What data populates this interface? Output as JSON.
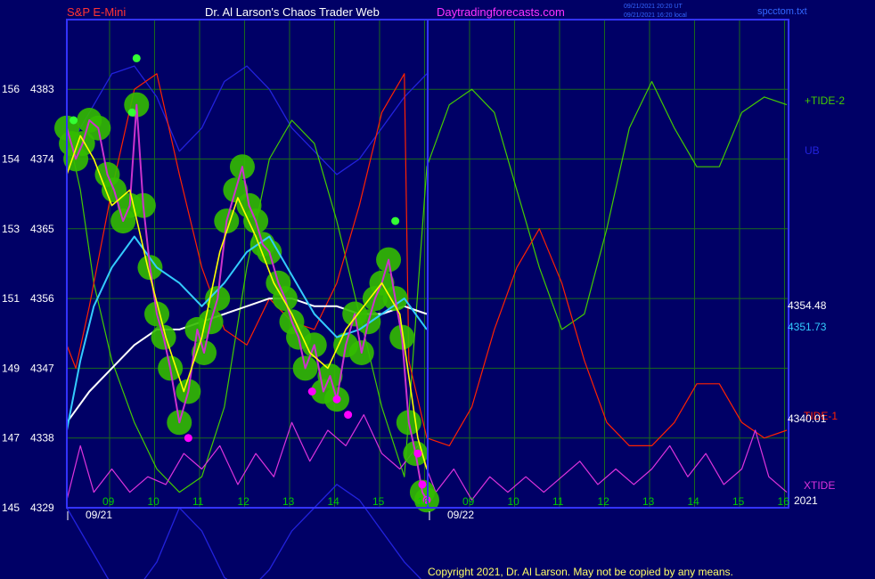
{
  "header": {
    "symbol": "S&P E-Mini",
    "title": "Dr. Al Larson's Chaos Trader Web",
    "site": "Daytradingforecasts.com",
    "stamp1": "09/21/2021 20:20 UT",
    "stamp2": "09/21/2021 16:20 local",
    "file": "spcctom.txt"
  },
  "copyright": "Copyright 2021, Dr. Al Larson. May not be copied by any means.",
  "colors": {
    "background": "#000066",
    "plot_border": "#3333ff",
    "grid": "#1a6b1a",
    "axis_text": "#ffffff",
    "hour_text": "#00cc00",
    "tide2": "#44cc00",
    "ub": "#2222dd",
    "xtide": "#dd33dd",
    "tide1": "#ff2200",
    "avg_white": "#ffffff",
    "avg_cyan": "#33ccff",
    "price": "#cc33cc",
    "smoothed": "#ffff00",
    "glow": "#33bb00",
    "high_dot": "#33ff33",
    "low_dot": "#ff00ff"
  },
  "chart_data": {
    "type": "line",
    "title": "S&P E-Mini",
    "y_ticks": [
      {
        "left": "145",
        "right": "4329"
      },
      {
        "left": "147",
        "right": "4338"
      },
      {
        "left": "149",
        "right": "4347"
      },
      {
        "left": "151",
        "right": "4356"
      },
      {
        "left": "153",
        "right": "4365"
      },
      {
        "left": "154",
        "right": "4374"
      },
      {
        "left": "156",
        "right": "4383"
      }
    ],
    "ylim": [
      4329,
      4390
    ],
    "x_hour_labels": [
      "09",
      "10",
      "11",
      "12",
      "13",
      "14",
      "15",
      "16",
      "09",
      "10",
      "11",
      "12",
      "13",
      "14",
      "15",
      "16"
    ],
    "date_labels": [
      "09/21",
      "09/22"
    ],
    "right_labels": [
      {
        "text": "+TIDE-2",
        "color": "#44cc00"
      },
      {
        "text": "UB",
        "color": "#2222dd"
      },
      {
        "text": "4354.48",
        "color": "#ffffff"
      },
      {
        "text": "4351.73",
        "color": "#33ccff"
      },
      {
        "text": "TIDE-1",
        "color": "#ff2200"
      },
      {
        "text": "4340.01",
        "color": "#ffffff"
      },
      {
        "text": "XTIDE",
        "color": "#dd33dd"
      },
      {
        "text": "2021",
        "color": "#ffffff"
      }
    ],
    "grid": true,
    "series": [
      {
        "name": "+TIDE-2",
        "x": [
          0,
          0.3,
          0.6,
          1.0,
          1.5,
          2.0,
          2.5,
          3.0,
          3.5,
          4.0,
          4.5,
          5.0,
          5.5,
          6.0,
          6.5,
          7.0,
          7.5,
          8.0,
          8.5,
          9.0,
          9.5,
          10.0,
          10.5,
          11.0,
          11.5,
          12.0,
          12.5,
          13.0,
          13.5,
          14.0,
          14.5,
          15.0,
          15.5,
          16.0
        ],
        "values": [
          4378,
          4370,
          4358,
          4348,
          4340,
          4334,
          4331,
          4333,
          4342,
          4360,
          4374,
          4379,
          4376,
          4366,
          4354,
          4342,
          4333,
          4373,
          4381,
          4383,
          4380,
          4370,
          4360,
          4352,
          4354,
          4365,
          4378,
          4384,
          4378,
          4373,
          4373,
          4380,
          4382,
          4381
        ]
      },
      {
        "name": "UB",
        "x": [
          0,
          0.5,
          1.0,
          1.5,
          2.0,
          2.5,
          3.0,
          3.5,
          4.0,
          4.5,
          5.0,
          5.5,
          6.0,
          6.5,
          7.0,
          7.5,
          8.0
        ],
        "values": [
          4375,
          4380,
          4385,
          4386,
          4382,
          4375,
          4378,
          4384,
          4386,
          4383,
          4378,
          4375,
          4372,
          4374,
          4378,
          4382,
          4385
        ]
      },
      {
        "name": "TIDE-1",
        "x": [
          0,
          0.2,
          0.5,
          1.0,
          1.5,
          2.0,
          2.5,
          3.0,
          3.5,
          4.0,
          4.5,
          5.0,
          5.5,
          6.0,
          6.5,
          7.0,
          7.5,
          7.6,
          8.0,
          8.5,
          9.0,
          9.5,
          10.0,
          10.5,
          11.0,
          11.5,
          12.0,
          12.5,
          13.0,
          13.5,
          14.0,
          14.5,
          15.0,
          15.5,
          16.0
        ],
        "values": [
          4350,
          4347,
          4355,
          4370,
          4383,
          4385,
          4372,
          4360,
          4352,
          4350,
          4356,
          4353,
          4352,
          4358,
          4368,
          4380,
          4385,
          4348,
          4338,
          4337,
          4342,
          4352,
          4360,
          4365,
          4358,
          4348,
          4340,
          4337,
          4337,
          4340,
          4345,
          4345,
          4340,
          4338,
          4339
        ]
      },
      {
        "name": "XTIDE",
        "x": [
          0,
          0.3,
          0.6,
          1.0,
          1.4,
          1.8,
          2.2,
          2.6,
          3.0,
          3.4,
          3.8,
          4.2,
          4.6,
          5.0,
          5.4,
          5.8,
          6.2,
          6.6,
          7.0,
          7.4,
          7.8,
          8.2,
          8.6,
          9.0,
          9.4,
          9.8,
          10.2,
          10.6,
          11.0,
          11.4,
          11.8,
          12.2,
          12.6,
          13.0,
          13.4,
          13.8,
          14.2,
          14.6,
          15.0,
          15.3,
          15.6,
          16.0
        ],
        "values": [
          4330,
          4337,
          4331,
          4334,
          4331,
          4333,
          4332,
          4336,
          4334,
          4337,
          4332,
          4336,
          4333,
          4340,
          4335,
          4339,
          4337,
          4341,
          4336,
          4334,
          4337,
          4331,
          4334,
          4330,
          4333,
          4331,
          4333,
          4331,
          4333,
          4335,
          4332,
          4334,
          4332,
          4334,
          4337,
          4333,
          4336,
          4332,
          4334,
          4339,
          4333,
          4331
        ]
      },
      {
        "name": "avg-white",
        "x": [
          0,
          0.5,
          1.0,
          1.5,
          2.0,
          2.5,
          3.0,
          3.5,
          4.0,
          4.5,
          5.0,
          5.5,
          6.0,
          6.5,
          7.0,
          7.5,
          8.0
        ],
        "values": [
          4340,
          4344,
          4347,
          4350,
          4352,
          4352,
          4353,
          4354,
          4355,
          4356,
          4356,
          4355,
          4355,
          4354,
          4354,
          4355,
          4354
        ]
      },
      {
        "name": "avg-cyan",
        "x": [
          0,
          0.3,
          0.6,
          1.0,
          1.5,
          2.0,
          2.5,
          3.0,
          3.5,
          4.0,
          4.5,
          5.0,
          5.5,
          6.0,
          6.5,
          7.0,
          7.5,
          8.0
        ],
        "values": [
          4339,
          4348,
          4355,
          4360,
          4364,
          4360,
          4358,
          4355,
          4358,
          4362,
          4364,
          4359,
          4354,
          4351,
          4352,
          4354,
          4356,
          4352
        ]
      },
      {
        "name": "price",
        "x": [
          0,
          0.1,
          0.2,
          0.35,
          0.5,
          0.7,
          0.9,
          1.05,
          1.25,
          1.4,
          1.55,
          1.7,
          1.85,
          2.0,
          2.15,
          2.3,
          2.5,
          2.7,
          2.9,
          3.05,
          3.2,
          3.35,
          3.55,
          3.75,
          3.9,
          4.05,
          4.2,
          4.35,
          4.5,
          4.7,
          4.85,
          5.0,
          5.15,
          5.3,
          5.5,
          5.7,
          5.85,
          6.0,
          6.2,
          6.4,
          6.55,
          6.7,
          6.85,
          7.0,
          7.15,
          7.3,
          7.45,
          7.6,
          7.75,
          7.9,
          8.0
        ],
        "values": [
          4378,
          4376,
          4374,
          4376,
          4379,
          4378,
          4372,
          4370,
          4366,
          4368,
          4381,
          4368,
          4360,
          4354,
          4351,
          4347,
          4340,
          4344,
          4352,
          4349,
          4353,
          4356,
          4366,
          4370,
          4373,
          4368,
          4366,
          4363,
          4362,
          4358,
          4356,
          4353,
          4351,
          4347,
          4350,
          4344,
          4346,
          4343,
          4350,
          4354,
          4349,
          4353,
          4356,
          4358,
          4361,
          4356,
          4351,
          4340,
          4336,
          4331,
          4330
        ]
      },
      {
        "name": "smoothed",
        "x": [
          0,
          0.3,
          0.6,
          1.0,
          1.4,
          1.8,
          2.2,
          2.6,
          3.0,
          3.4,
          3.8,
          4.2,
          4.6,
          5.0,
          5.4,
          5.8,
          6.2,
          6.6,
          7.0,
          7.4,
          7.8,
          8.0
        ],
        "values": [
          4372,
          4377,
          4374,
          4368,
          4370,
          4360,
          4351,
          4344,
          4351,
          4362,
          4369,
          4364,
          4358,
          4354,
          4349,
          4347,
          4352,
          4355,
          4358,
          4354,
          4338,
          4334
        ]
      }
    ],
    "high_markers": [
      {
        "x": 0.15,
        "y": 4379
      },
      {
        "x": 1.55,
        "y": 4387
      },
      {
        "x": 1.45,
        "y": 4380
      },
      {
        "x": 7.3,
        "y": 4366
      }
    ],
    "low_markers": [
      {
        "x": 2.7,
        "y": 4338
      },
      {
        "x": 5.45,
        "y": 4344
      },
      {
        "x": 6.0,
        "y": 4343
      },
      {
        "x": 6.25,
        "y": 4341
      },
      {
        "x": 7.8,
        "y": 4336
      },
      {
        "x": 7.9,
        "y": 4332
      },
      {
        "x": 8.0,
        "y": 4330
      }
    ]
  }
}
